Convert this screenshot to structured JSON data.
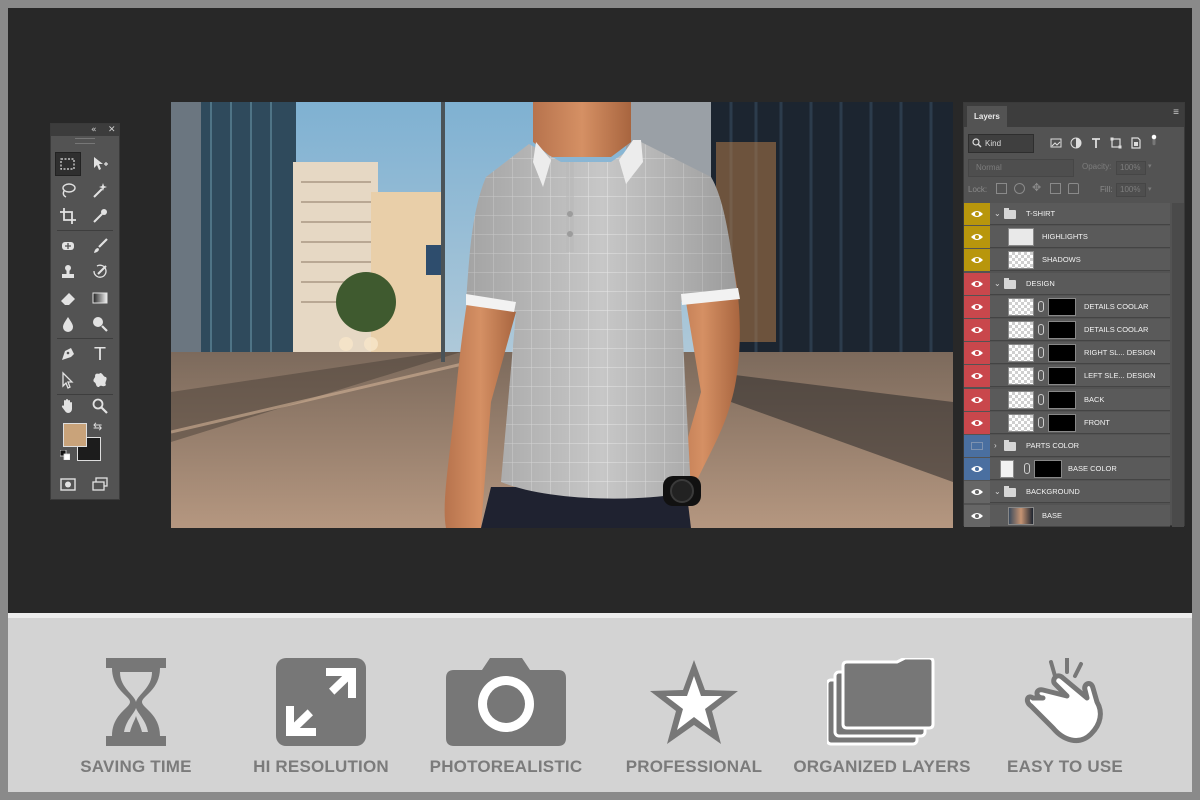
{
  "toolbox": {
    "collapse_icon": "double-chevron-left-icon",
    "close_icon": "close-icon",
    "foreground_color": "#c9a37a",
    "background_color": "#1c1c1c",
    "tools": [
      "rectangular-marquee-icon",
      "move-icon",
      "lasso-icon",
      "magic-wand-icon",
      "crop-icon",
      "eyedropper-icon",
      "spot-healing-icon",
      "brush-icon",
      "clone-stamp-icon",
      "history-brush-icon",
      "eraser-icon",
      "gradient-icon",
      "blur-icon",
      "dodge-icon",
      "pen-icon",
      "type-icon",
      "path-selection-icon",
      "custom-shape-icon",
      "hand-icon",
      "zoom-icon",
      "quick-mask-icon",
      "screen-mode-icon"
    ],
    "type_glyph": "T"
  },
  "layers_panel": {
    "tab_label": "Layers",
    "filter_kind": "Kind",
    "blend_mode": "Normal",
    "opacity_label": "Opacity:",
    "opacity_value": "100%",
    "lock_label": "Lock:",
    "fill_label": "Fill:",
    "fill_value": "100%",
    "layers": [
      {
        "name": "T-SHIRT",
        "type": "group",
        "expanded": true,
        "color": "#b8960c",
        "indent": 0
      },
      {
        "name": "HIGHLIGHTS",
        "type": "layer",
        "color": "#b8960c",
        "indent": 1,
        "thumb": "shirt"
      },
      {
        "name": "SHADOWS",
        "type": "layer",
        "color": "#b8960c",
        "indent": 1,
        "thumb": "transparent"
      },
      {
        "name": "DESIGN",
        "type": "group",
        "expanded": true,
        "color": "#c9474c",
        "indent": 0
      },
      {
        "name": "DETAILS COOLAR",
        "type": "smart",
        "color": "#c9474c",
        "indent": 1
      },
      {
        "name": "DETAILS COOLAR",
        "type": "smart",
        "color": "#c9474c",
        "indent": 1
      },
      {
        "name": "RIGHT SL... DESIGN",
        "type": "smart",
        "color": "#c9474c",
        "indent": 1
      },
      {
        "name": "LEFT SLE... DESIGN",
        "type": "smart",
        "color": "#c9474c",
        "indent": 1
      },
      {
        "name": "BACK",
        "type": "smart",
        "color": "#c9474c",
        "indent": 1
      },
      {
        "name": "FRONT",
        "type": "smart",
        "color": "#c9474c",
        "indent": 1
      },
      {
        "name": "PARTS COLOR",
        "type": "group",
        "expanded": false,
        "color": "#4a6fa0",
        "indent": 0,
        "hidden": true
      },
      {
        "name": "BASE COLOR",
        "type": "solid",
        "color": "#4a6fa0",
        "indent": 0
      },
      {
        "name": "BACKGROUND",
        "type": "group",
        "expanded": true,
        "color": "#666666",
        "indent": 0
      },
      {
        "name": "BASE",
        "type": "image",
        "color": "#666666",
        "indent": 1
      }
    ]
  },
  "features": [
    {
      "icon": "hourglass-icon",
      "label": "SAVING TIME"
    },
    {
      "icon": "resize-arrows-icon",
      "label": "HI RESOLUTION"
    },
    {
      "icon": "camera-icon",
      "label": "PHOTOREALISTIC"
    },
    {
      "icon": "star-icon",
      "label": "PROFESSIONAL"
    },
    {
      "icon": "stacked-folders-icon",
      "label": "ORGANIZED LAYERS"
    },
    {
      "icon": "finger-snap-icon",
      "label": "EASY TO USE"
    }
  ]
}
